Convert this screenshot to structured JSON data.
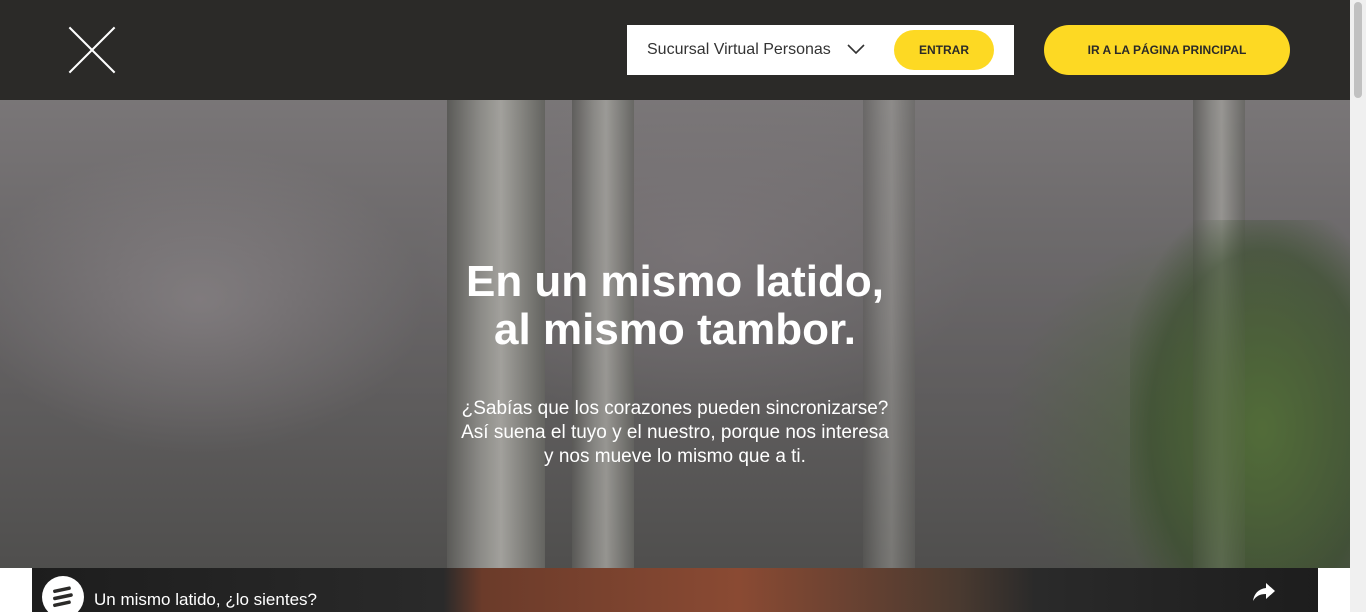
{
  "header": {
    "logo_icon": "x-logo-icon",
    "login": {
      "select_value": "Sucursal Virtual Personas",
      "enter_label": "ENTRAR"
    },
    "home_button_label": "IR A LA PÁGINA PRINCIPAL"
  },
  "hero": {
    "title_line1": "En un mismo latido,",
    "title_line2": "al mismo tambor.",
    "text_line1": "¿Sabías que los corazones pueden sincronizarse?",
    "text_line2": "Así suena el tuyo y el nuestro, porque nos interesa",
    "text_line3": "y nos mueve lo mismo que a ti."
  },
  "video": {
    "title": "Un mismo latido, ¿lo sientes?",
    "share_icon": "share-icon"
  },
  "colors": {
    "header_bg": "#2b2a28",
    "accent_yellow": "#fdd923"
  }
}
